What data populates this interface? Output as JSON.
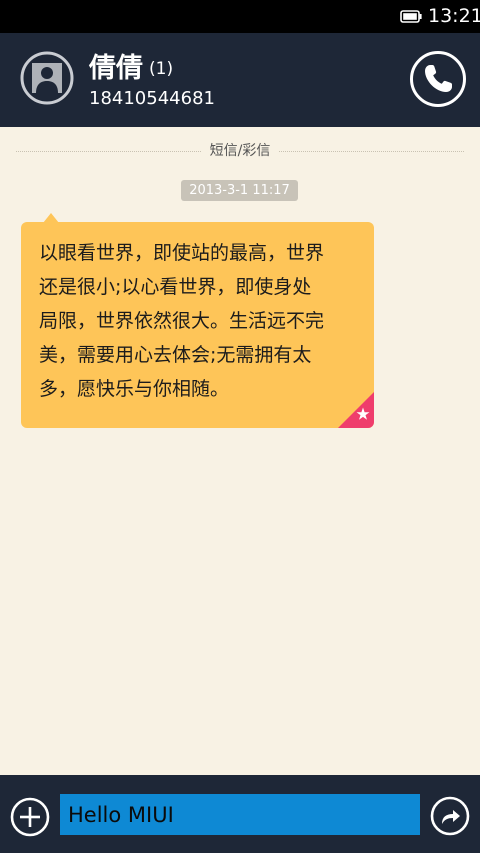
{
  "status_bar": {
    "time": "13:21",
    "battery_icon": "battery-icon"
  },
  "header": {
    "avatar_icon": "contact-avatar-icon",
    "contact_name": "倩倩",
    "unread_count": "(1)",
    "phone_number": "18410544681",
    "call_icon": "phone-icon"
  },
  "conversation": {
    "divider_label": "短信/彩信",
    "messages": [
      {
        "timestamp": "2013-3-1 11:17",
        "direction": "incoming",
        "lines": [
          "以眼看世界，即使站的最高，世界",
          "还是很小;以心看世界，即使身处",
          "局限，世界依然很大。生活远不完",
          "美，需要用心去体会;无需拥有太",
          "多，愿快乐与你相随。"
        ],
        "starred": true,
        "star_icon": "star-icon",
        "bubble_color": "#fec558",
        "badge_color": "#ef3d6c"
      }
    ]
  },
  "input_bar": {
    "add_icon": "plus-icon",
    "input_value": "Hello MIUI",
    "send_icon": "send-arrow-icon",
    "input_color": "#0e89d4"
  },
  "colors": {
    "header_bg": "#1e2737",
    "status_bg": "#000000",
    "page_bg": "#f8f2e4",
    "timestamp_bg": "#c8c3b8"
  }
}
